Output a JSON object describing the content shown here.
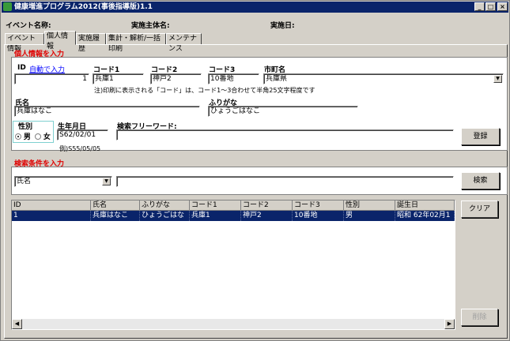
{
  "window": {
    "title": "健康増進プログラム2012(事後指導版)1.1"
  },
  "header": {
    "event_name_label": "イベント名称:",
    "organizer_label": "実施主体名:",
    "date_label": "実施日:"
  },
  "tabs": [
    "イベント情報",
    "個人情報",
    "実施履歴",
    "集計・解析/一括印刷",
    "メンテナンス"
  ],
  "personal": {
    "section_title": "個人情報を入力",
    "id_label": "ID",
    "auto_input_link": "自動で入力",
    "id_value": "1",
    "code1_label": "コード1",
    "code1_value": "兵庫1",
    "code2_label": "コード2",
    "code2_value": "神戸2",
    "code3_label": "コード3",
    "code3_value": "10番地",
    "city_label": "市町名",
    "city_value": "兵庫県",
    "note": "注)印刷に表示される「コード」は、コード1〜3合わせて半角25文字程度です",
    "name_label": "氏名",
    "name_value": "兵庫はなこ",
    "kana_label": "ふりがな",
    "kana_value": "ひょうごはなこ",
    "gender_label": "性別",
    "gender_male": "男",
    "gender_female": "女",
    "gender_selected": "男",
    "birth_label": "生年月日",
    "birth_value": "S62/02/01",
    "birth_example": "例)S55/05/05",
    "keyword_label": "検索フリーワード:",
    "keyword_value": "",
    "register_button": "登録"
  },
  "search": {
    "section_title": "検索条件を入力",
    "field_value": "氏名",
    "query_value": "",
    "search_button": "検索"
  },
  "results": {
    "columns": [
      "ID",
      "氏名",
      "ふりがな",
      "コード1",
      "コード2",
      "コード3",
      "性別",
      "誕生日"
    ],
    "rows": [
      [
        "1",
        "兵庫はなこ",
        "ひょうごはなこ",
        "兵庫1",
        "神戸2",
        "10番地",
        "男",
        "昭和 62年02月1日"
      ]
    ]
  },
  "buttons": {
    "clear": "クリア",
    "delete": "削除"
  }
}
